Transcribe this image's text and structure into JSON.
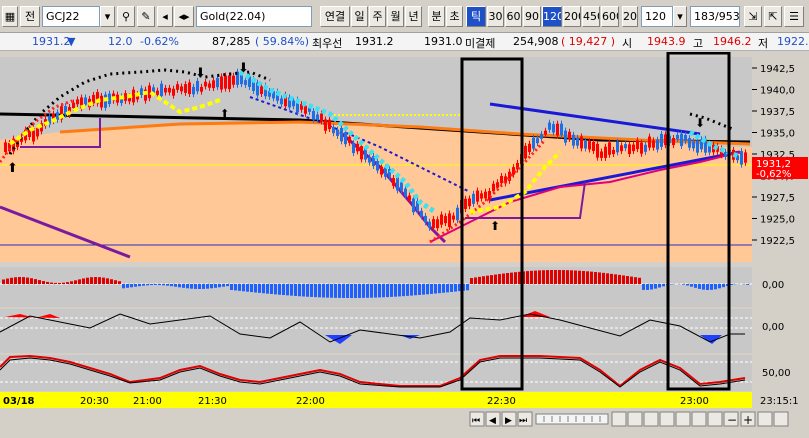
{
  "toolbar": {
    "lead_label": "전",
    "symbol": "GCJ22",
    "name": "Gold(22.04)",
    "modes": [
      "연결",
      "일",
      "주",
      "월",
      "년",
      "분",
      "초",
      "틱"
    ],
    "intervals": [
      "30",
      "60",
      "90",
      "120",
      "200",
      "450",
      "600",
      "20"
    ],
    "interval_value": "120",
    "range_readout": "183/953"
  },
  "quote": {
    "last": "1931.2",
    "change": "12.0",
    "change_pct": "-0.62%",
    "volume": "87,285",
    "volume_ratio": "( 59.84%)",
    "best_ask_label": "최우선",
    "best_ask": "1931.2",
    "settle_price": "1931.0",
    "open_interest_label": "미결제",
    "open_interest": "254,908",
    "open_interest_change": "( 19,427 )",
    "open_label": "시",
    "open": "1943.9",
    "high_label": "고",
    "high": "1946.2",
    "low_label": "저",
    "low": "1922."
  },
  "price_axis": {
    "ticks": [
      "1942,5",
      "1940,0",
      "1937,5",
      "1935,0",
      "1932,5",
      "1930,0",
      "1927,5",
      "1925,0",
      "1922,5"
    ],
    "current_price_tag": "1931,2",
    "current_change_tag": "-0,62%"
  },
  "indicator_axes": {
    "macd_tick": "0,00",
    "osc_tick": "0,00",
    "stoch_tick": "50,00"
  },
  "time_axis": {
    "date_label": "03/18",
    "ticks": [
      "20:30",
      "21:00",
      "21:30",
      "22:00",
      "22:30",
      "23:00"
    ],
    "end_time": "23:15:1"
  },
  "colors": {
    "up_candle": "#ff0000",
    "down_candle": "#1e6ee6",
    "cloud": "#ffc896",
    "highlight_box": "#000000",
    "time_bar": "#ffff00"
  }
}
